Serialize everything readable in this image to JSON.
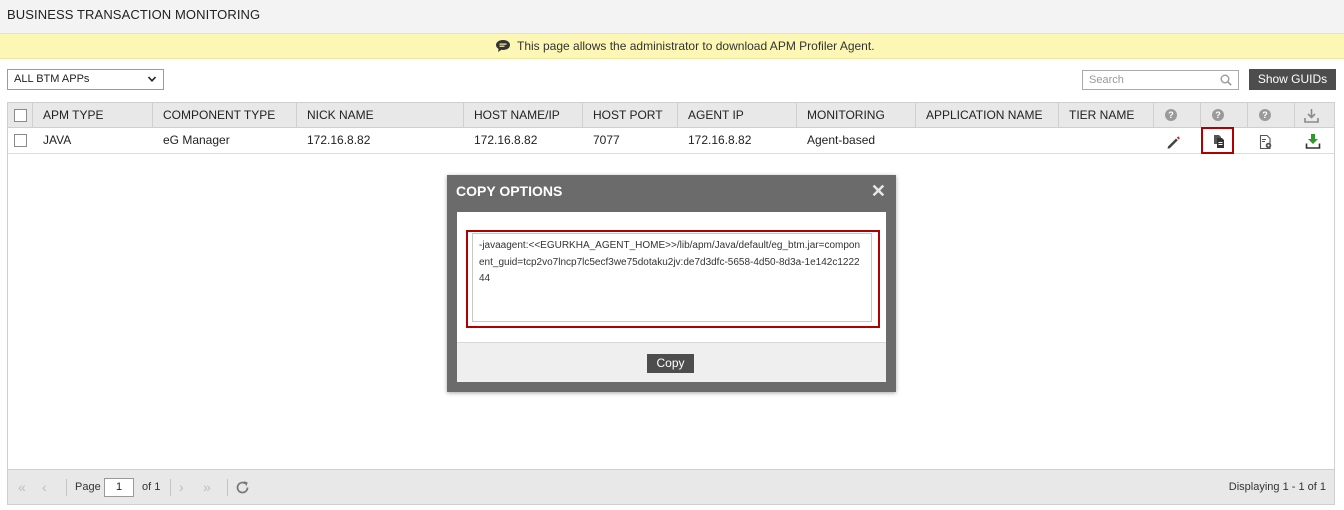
{
  "page": {
    "title": "BUSINESS TRANSACTION MONITORING"
  },
  "info_bar": {
    "icon": "speech-bubble-icon",
    "message": "This page allows the administrator to download APM Profiler Agent."
  },
  "filter": {
    "selected": "ALL BTM APPs"
  },
  "search": {
    "placeholder": "Search"
  },
  "show_guids_label": "Show GUIDs",
  "table": {
    "columns": [
      "APM TYPE",
      "COMPONENT TYPE",
      "NICK NAME",
      "HOST NAME/IP",
      "HOST PORT",
      "AGENT IP",
      "MONITORING",
      "APPLICATION NAME",
      "TIER NAME"
    ],
    "action_column_icons": [
      "help-icon",
      "help-icon",
      "help-icon",
      "download-icon"
    ],
    "rows": [
      {
        "apm_type": "JAVA",
        "component_type": "eG Manager",
        "nick_name": "172.16.8.82",
        "host": "172.16.8.82",
        "port": "7077",
        "agent_ip": "172.16.8.82",
        "monitoring": "Agent-based",
        "application_name": "",
        "tier_name": "",
        "actions": [
          "edit-icon",
          "copy-icon",
          "settings-file-icon",
          "download-agent-icon"
        ]
      }
    ]
  },
  "pager": {
    "page_label": "Page",
    "page_value": "1",
    "of_label": "of 1",
    "display_text": "Displaying 1 - 1 of 1"
  },
  "modal": {
    "title": "COPY OPTIONS",
    "close_glyph": "✕",
    "command": "-javaagent:<<EGURKHA_AGENT_HOME>>/lib/apm/Java/default/eg_btm.jar=component_guid=tcp2vo7lncp7lc5ecf3we75dotaku2jv:de7d3dfc-5658-4d50-8d3a-1e142c122244",
    "copy_label": "Copy"
  },
  "colors": {
    "accent_red": "#b00000",
    "button_dark": "#4d4d4d",
    "info_yellow": "#fcf7b4",
    "download_green": "#2e9a2e"
  }
}
